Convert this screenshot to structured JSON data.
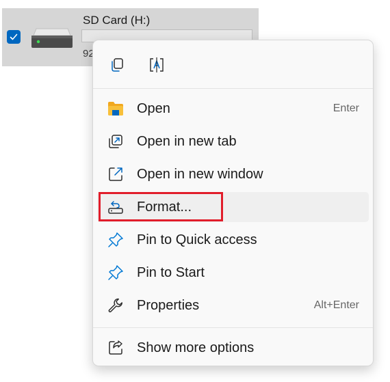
{
  "drive": {
    "name": "SD Card (H:)",
    "free_space_text": "92",
    "usage_fraction": 0.0,
    "checked": true
  },
  "quick_actions": [
    {
      "icon": "copy-icon"
    },
    {
      "icon": "rename-icon"
    }
  ],
  "menu_items": [
    {
      "label": "Open",
      "shortcut": "Enter",
      "icon": "folder-icon"
    },
    {
      "label": "Open in new tab",
      "shortcut": "",
      "icon": "open-new-tab-icon"
    },
    {
      "label": "Open in new window",
      "shortcut": "",
      "icon": "open-new-window-icon"
    },
    {
      "label": "Format...",
      "shortcut": "",
      "icon": "format-drive-icon",
      "hovered": true
    },
    {
      "label": "Pin to Quick access",
      "shortcut": "",
      "icon": "pin-icon"
    },
    {
      "label": "Pin to Start",
      "shortcut": "",
      "icon": "pin-icon"
    },
    {
      "label": "Properties",
      "shortcut": "Alt+Enter",
      "icon": "wrench-icon"
    }
  ],
  "more_options": {
    "label": "Show more options",
    "icon": "share-icon"
  },
  "colors": {
    "accent": "#0067c0",
    "highlight": "#e11d2a",
    "folder": "#f8c03b",
    "pin": "#0078d4"
  }
}
